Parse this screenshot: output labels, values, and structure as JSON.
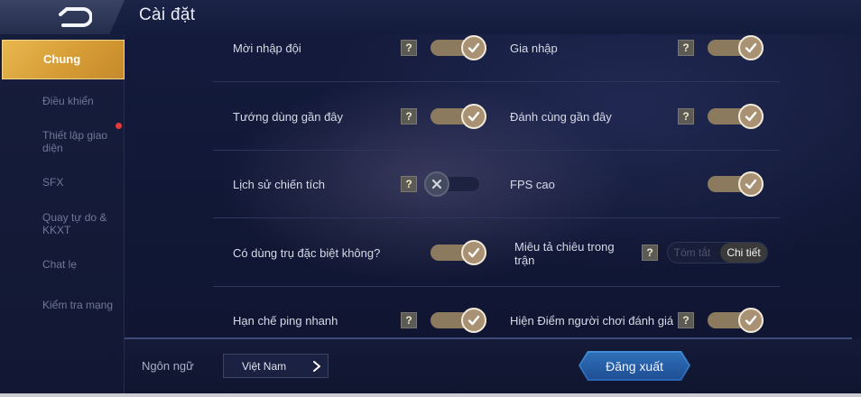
{
  "header": {
    "title": "Cài đặt",
    "back_icon": "back-arrow-icon"
  },
  "sidebar": {
    "items": [
      {
        "label": "Chung",
        "active": true
      },
      {
        "label": "Điều khiển",
        "active": false
      },
      {
        "label": "Thiết lập giao diện",
        "active": false,
        "badge": "red-dot"
      },
      {
        "label": "SFX",
        "active": false
      },
      {
        "label": "Quay tự do & KKXT",
        "active": false
      },
      {
        "label": "Chat lẹ",
        "active": false
      },
      {
        "label": "Kiểm tra mạng",
        "active": false
      }
    ]
  },
  "settings": {
    "help_label": "?",
    "rows": [
      {
        "left": {
          "label": "Mời nhập đội",
          "help": true,
          "state": "on"
        },
        "right": {
          "label": "Gia nhập",
          "help": true,
          "state": "on"
        }
      },
      {
        "left": {
          "label": "Tướng dùng gần đây",
          "help": true,
          "state": "on"
        },
        "right": {
          "label": "Đánh cùng gần đây",
          "help": true,
          "state": "on"
        }
      },
      {
        "left": {
          "label": "Lịch sử chiến tích",
          "help": true,
          "state": "off"
        },
        "right": {
          "label": "FPS cao",
          "help": false,
          "state": "on"
        }
      },
      {
        "left": {
          "label": "Có dùng trụ đặc biệt không?",
          "help": false,
          "state": "on"
        },
        "right": {
          "label": "Miêu tả chiêu trong trận",
          "help": true,
          "options": [
            "Tóm tắt",
            "Chi tiết"
          ],
          "selected": "Chi tiết"
        }
      },
      {
        "left": {
          "label": "Hạn chế ping nhanh",
          "help": true,
          "state": "on"
        },
        "right": {
          "label": "Hiện Điểm người chơi đánh giá",
          "help": true,
          "state": "on"
        }
      }
    ]
  },
  "footer": {
    "language_label": "Ngôn ngữ",
    "language_value": "Việt Nam",
    "logout_label": "Đăng xuất"
  },
  "colors": {
    "accent_gold": "#e3ad48",
    "toggle_on": "#8c7a5f",
    "logout_blue": "#2f6fb8",
    "badge_red": "#e23a3a"
  }
}
